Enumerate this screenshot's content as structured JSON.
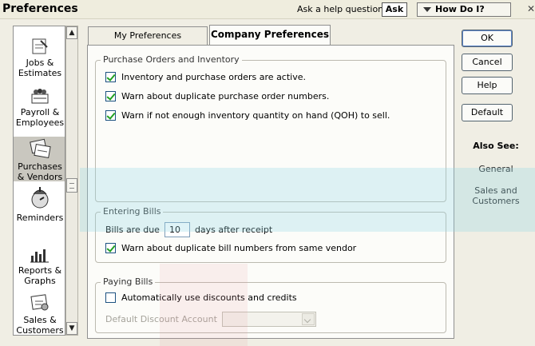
{
  "window": {
    "title": "Preferences",
    "help_label": "Ask a help question",
    "ask_button": "Ask",
    "how_do_i": "How Do I?",
    "close_symbol": "✕"
  },
  "sidebar": {
    "items": [
      {
        "label": "Jobs & Estimates",
        "icon": "jobs-estimates-icon"
      },
      {
        "label": "Payroll & Employees",
        "icon": "payroll-employees-icon"
      },
      {
        "label": "Purchases & Vendors",
        "icon": "purchases-vendors-icon",
        "selected": true
      },
      {
        "label": "Reminders",
        "icon": "reminders-icon"
      },
      {
        "label": "Reports & Graphs",
        "icon": "reports-graphs-icon"
      },
      {
        "label": "Sales & Customers",
        "icon": "sales-customers-icon"
      }
    ]
  },
  "tabs": [
    {
      "label": "My Preferences",
      "active": false
    },
    {
      "label": "Company Preferences",
      "active": true
    }
  ],
  "purchase_orders": {
    "legend": "Purchase Orders and Inventory",
    "options": [
      {
        "label": "Inventory and purchase orders are active.",
        "checked": true
      },
      {
        "label": "Warn about duplicate purchase order numbers.",
        "checked": true
      },
      {
        "label": "Warn if not enough inventory quantity on hand (QOH) to sell.",
        "checked": true
      }
    ]
  },
  "entering_bills": {
    "legend": "Entering Bills",
    "bills_due_prefix": "Bills are due",
    "days_value": "10",
    "days_suffix": "days after receipt",
    "warn_duplicate": {
      "label": "Warn about duplicate bill numbers from same vendor",
      "checked": true
    }
  },
  "paying_bills": {
    "legend": "Paying Bills",
    "auto_discounts": {
      "label": "Automatically use discounts and credits",
      "checked": false
    },
    "default_discount_label": "Default Discount Account",
    "default_discount_value": ""
  },
  "buttons": {
    "ok": "OK",
    "cancel": "Cancel",
    "help": "Help",
    "default": "Default"
  },
  "also_see": {
    "title": "Also See:",
    "links": [
      "General",
      "Sales and Customers"
    ]
  },
  "colors": {
    "checkmark": "#21a121",
    "selected_sidebar": "#c9c7bf"
  }
}
